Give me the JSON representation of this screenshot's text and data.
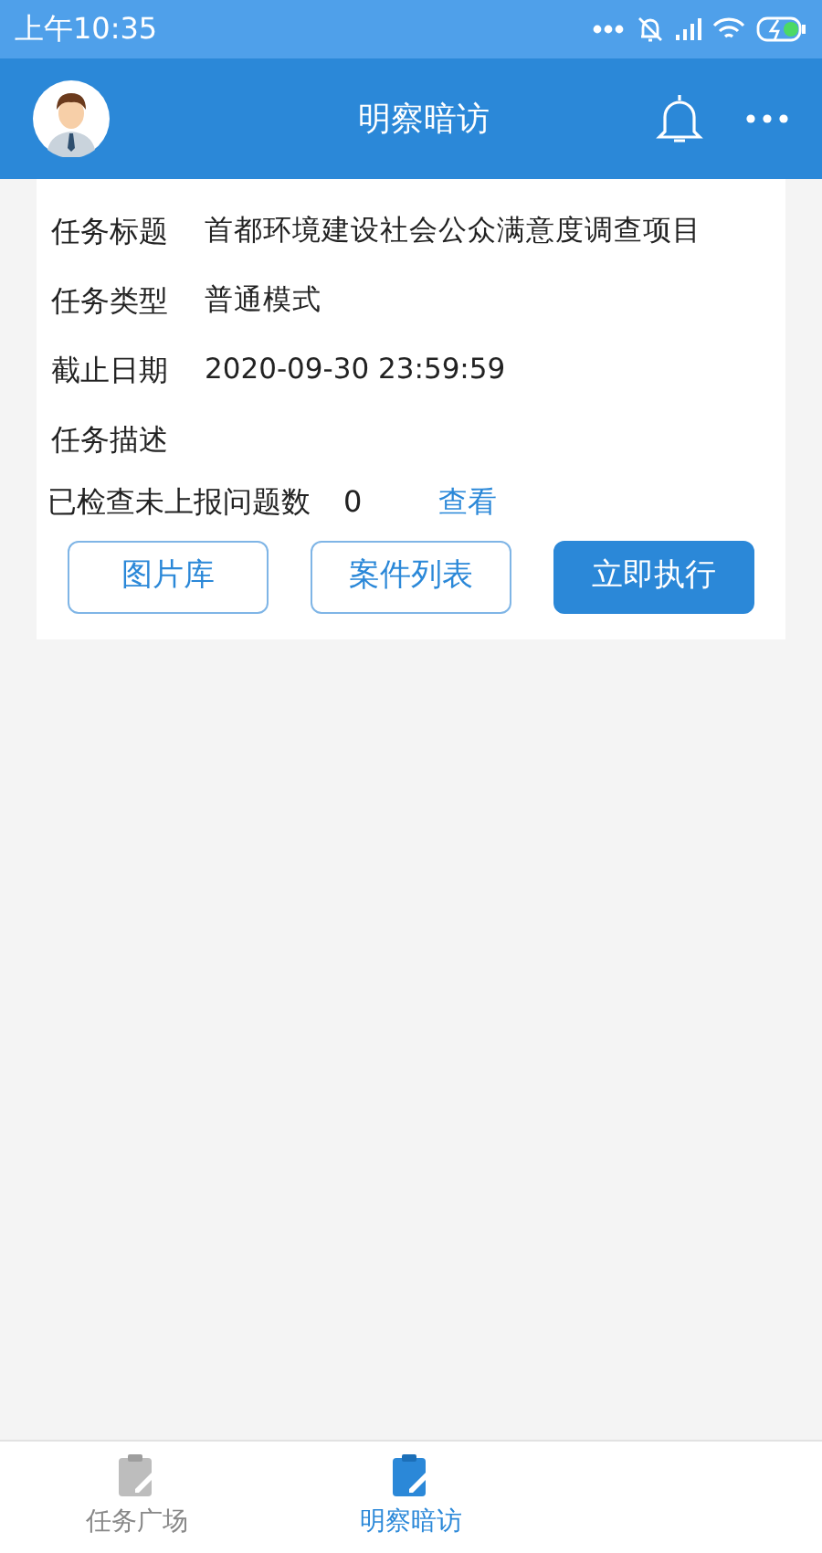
{
  "status_bar": {
    "time": "上午10:35"
  },
  "header": {
    "title": "明察暗访"
  },
  "task": {
    "fields": [
      {
        "label": "任务标题",
        "value": "首都环境建设社会公众满意度调查项目"
      },
      {
        "label": "任务类型",
        "value": "普通模式"
      },
      {
        "label": "截止日期",
        "value": "2020-09-30 23:59:59"
      },
      {
        "label": "任务描述"
      }
    ],
    "unreported": {
      "label": "已检查未上报问题数",
      "count": "0",
      "link": "查看"
    },
    "buttons": [
      {
        "label": "图片库",
        "kind": "outline"
      },
      {
        "label": "案件列表",
        "kind": "outline"
      },
      {
        "label": "立即执行",
        "kind": "primary"
      }
    ]
  },
  "tab_bar": [
    {
      "label": "任务广场",
      "selected": false
    },
    {
      "label": "明察暗访",
      "selected": true
    }
  ]
}
